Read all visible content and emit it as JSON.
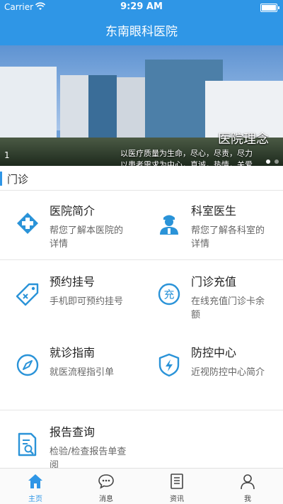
{
  "status_bar": {
    "carrier": "Carrier",
    "time": "9:29 AM"
  },
  "nav": {
    "title": "东南眼科医院"
  },
  "banner": {
    "index": "1",
    "headline": "医院理念",
    "line1": "以医疗质量为生命，尽心，尽责，尽力",
    "line2": "以患者需求为中心，真诚，热情，关爱"
  },
  "section": {
    "title": "门诊"
  },
  "services": [
    {
      "name": "医院简介",
      "desc": "帮您了解本医院的详情",
      "icon": "hospital-cross-icon"
    },
    {
      "name": "科室医生",
      "desc": "帮您了解各科室的详情",
      "icon": "doctor-icon"
    },
    {
      "name": "预约挂号",
      "desc": "手机即可预约挂号",
      "icon": "tag-icon"
    },
    {
      "name": "门诊充值",
      "desc": "在线充值门诊卡余额",
      "icon": "recharge-icon"
    },
    {
      "name": "就诊指南",
      "desc": "就医流程指引单",
      "icon": "compass-icon"
    },
    {
      "name": "防控中心",
      "desc": "近视防控中心简介",
      "icon": "shield-bolt-icon"
    },
    {
      "name": "报告查询",
      "desc": "检验/检查报告单查阅",
      "icon": "report-search-icon"
    }
  ],
  "tabs": [
    {
      "label": "主页",
      "icon": "home-icon",
      "active": true
    },
    {
      "label": "消息",
      "icon": "message-icon",
      "active": false
    },
    {
      "label": "资讯",
      "icon": "news-icon",
      "active": false
    },
    {
      "label": "我",
      "icon": "user-icon",
      "active": false
    }
  ],
  "colors": {
    "primary": "#2f96e6",
    "icon_blue": "#2a93d8"
  }
}
